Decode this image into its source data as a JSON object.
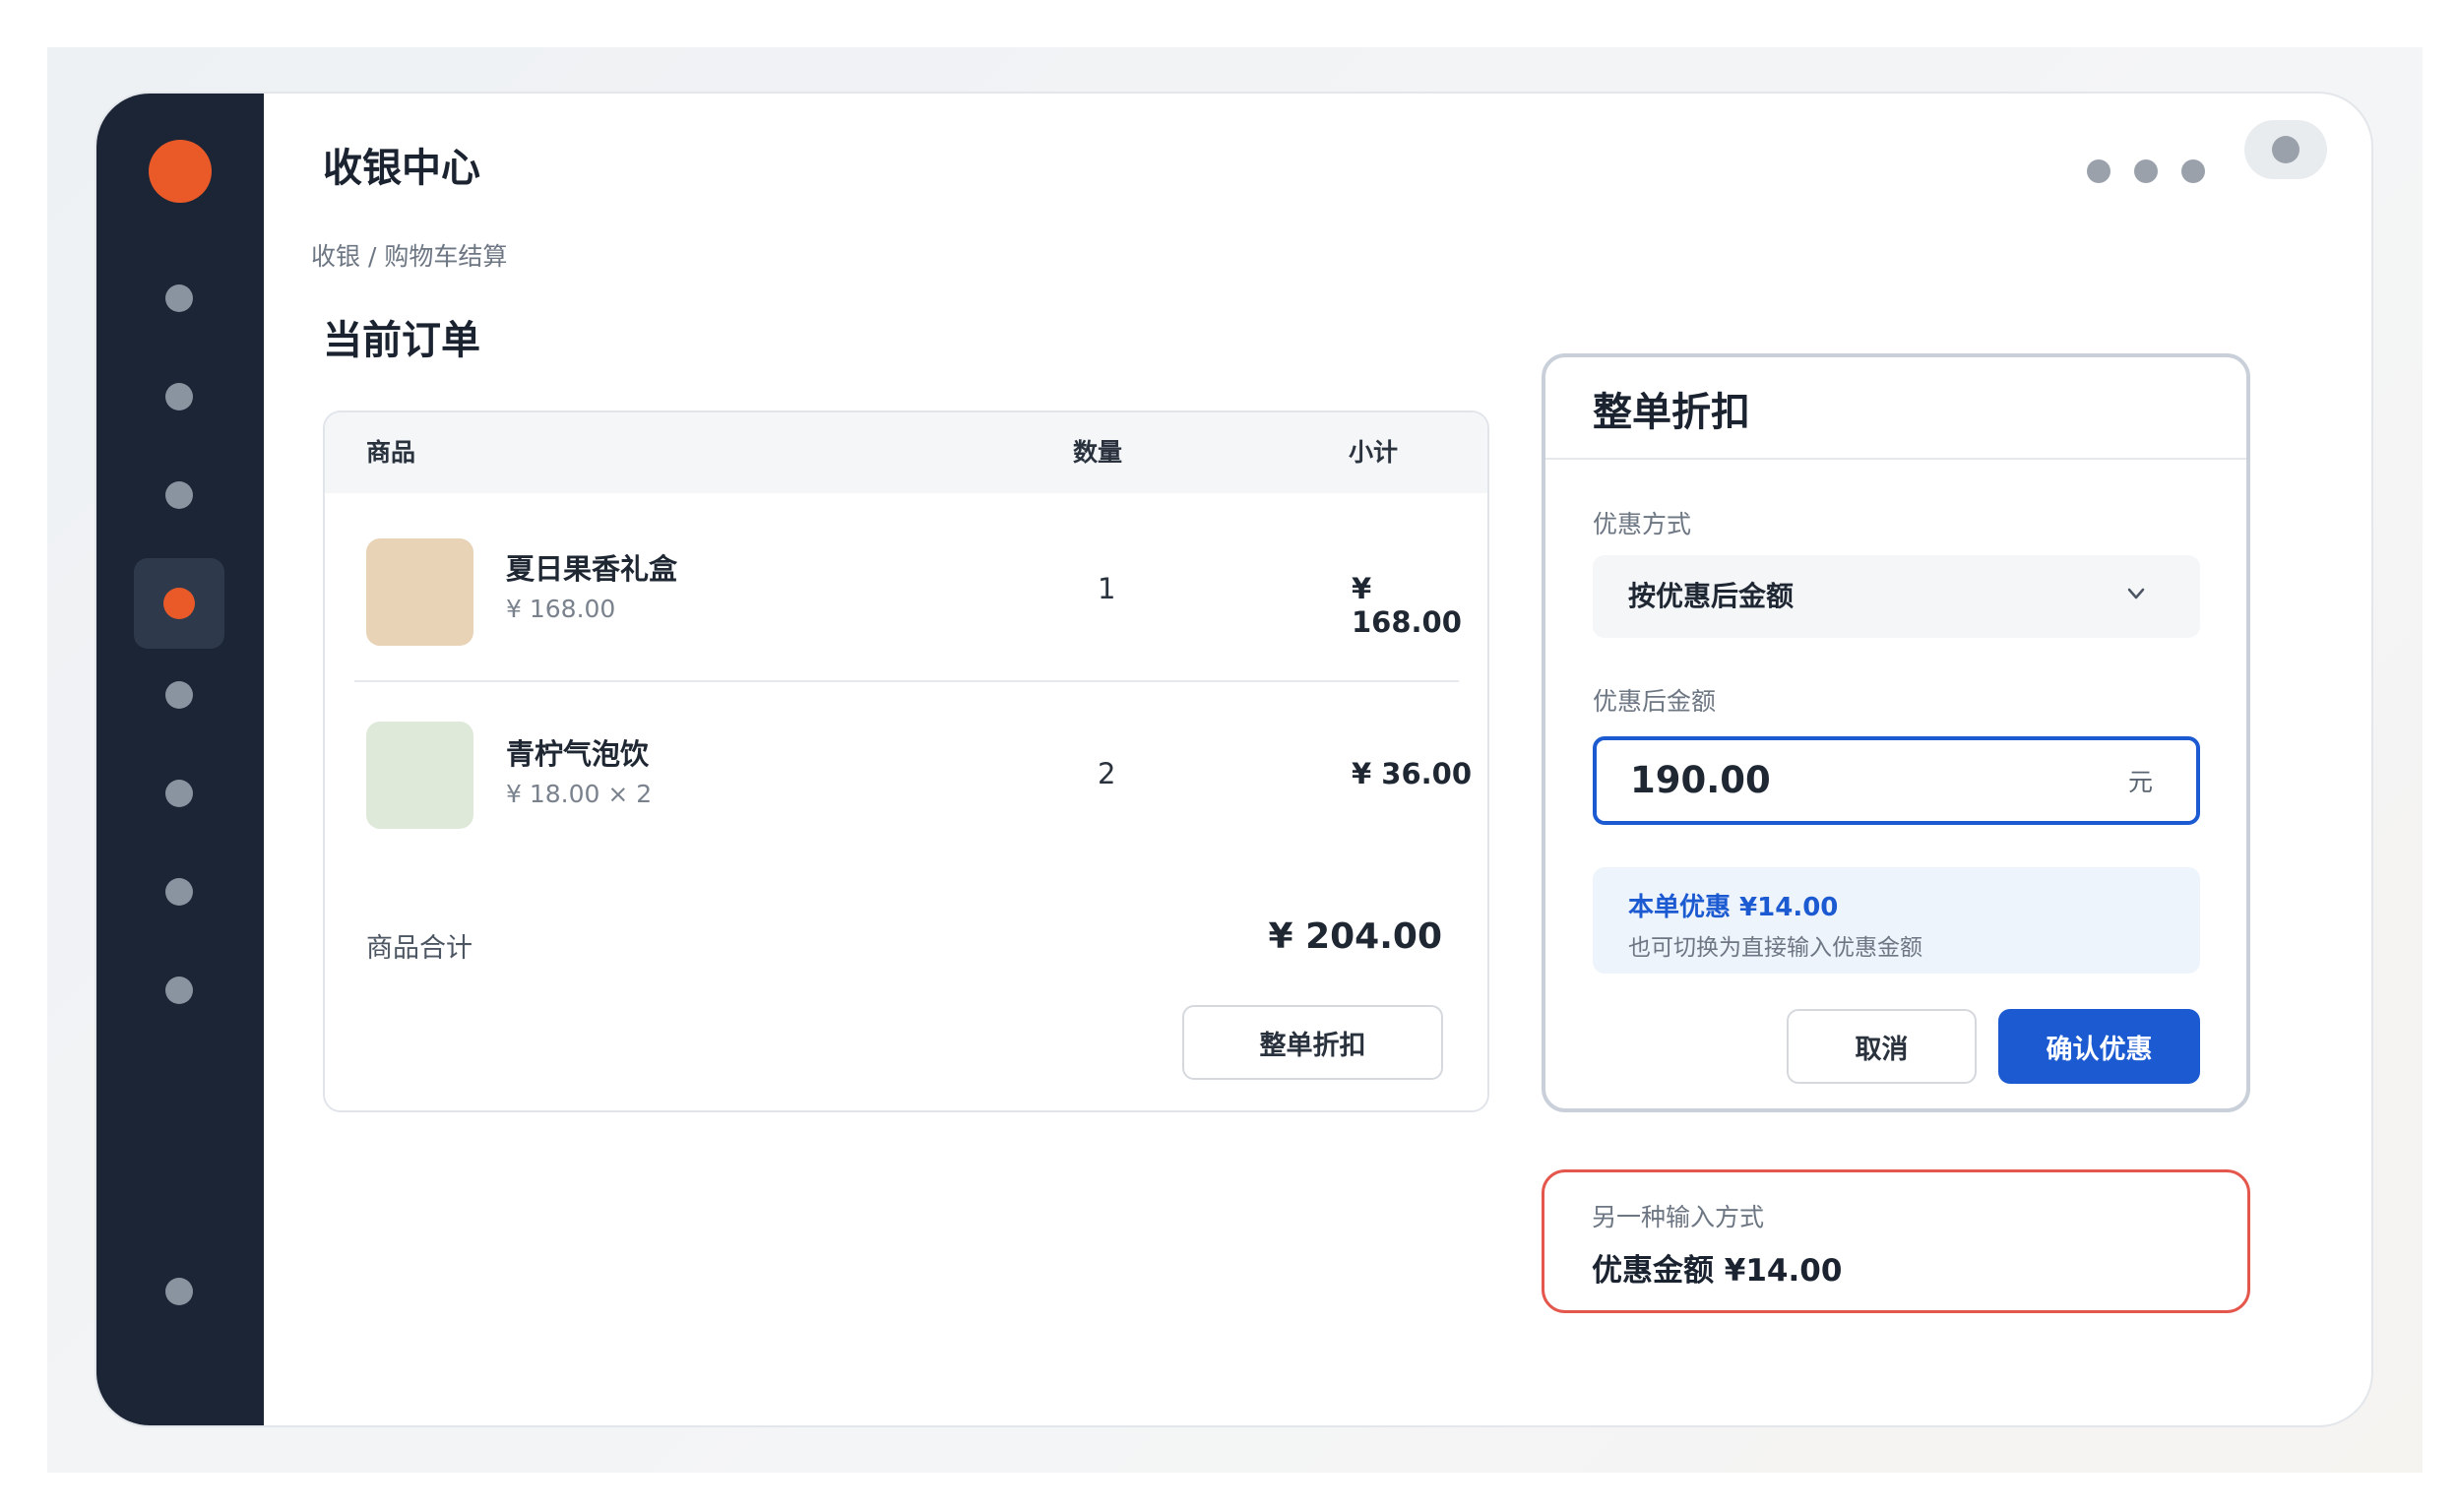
{
  "header": {
    "app_title": "收银中心"
  },
  "breadcrumb": "收银 / 购物车结算",
  "page_title": "当前订单",
  "order_table": {
    "columns": [
      "商品",
      "数量",
      "小计"
    ],
    "items": [
      {
        "name": "夏日果香礼盒",
        "price": "¥ 168.00",
        "qty": "1",
        "subtotal": "¥ 168.00",
        "thumb_color": "#e8d3b7"
      },
      {
        "name": "青柠气泡饮",
        "price": "¥ 18.00 × 2",
        "qty": "2",
        "subtotal": "¥ 36.00",
        "thumb_color": "#dfe9da"
      }
    ],
    "total_label": "商品合计",
    "total_value": "¥ 204.00",
    "discount_button": "整单折扣"
  },
  "discount_panel": {
    "title": "整单折扣",
    "mode_label": "优惠方式",
    "mode_value": "按优惠后金额",
    "amount_label": "优惠后金额",
    "amount_value": "190.00",
    "amount_unit": "元",
    "hint_title": "本单优惠 ¥14.00",
    "hint_sub": "也可切换为直接输入优惠金额",
    "cancel_label": "取消",
    "confirm_label": "确认优惠"
  },
  "alt_input": {
    "label": "另一种输入方式",
    "value": "优惠金额 ¥14.00"
  },
  "colors": {
    "sidebar_bg": "#1b2535",
    "accent_orange": "#ea5a29",
    "primary_blue": "#1c5ad1",
    "alert_red": "#e4574d"
  }
}
